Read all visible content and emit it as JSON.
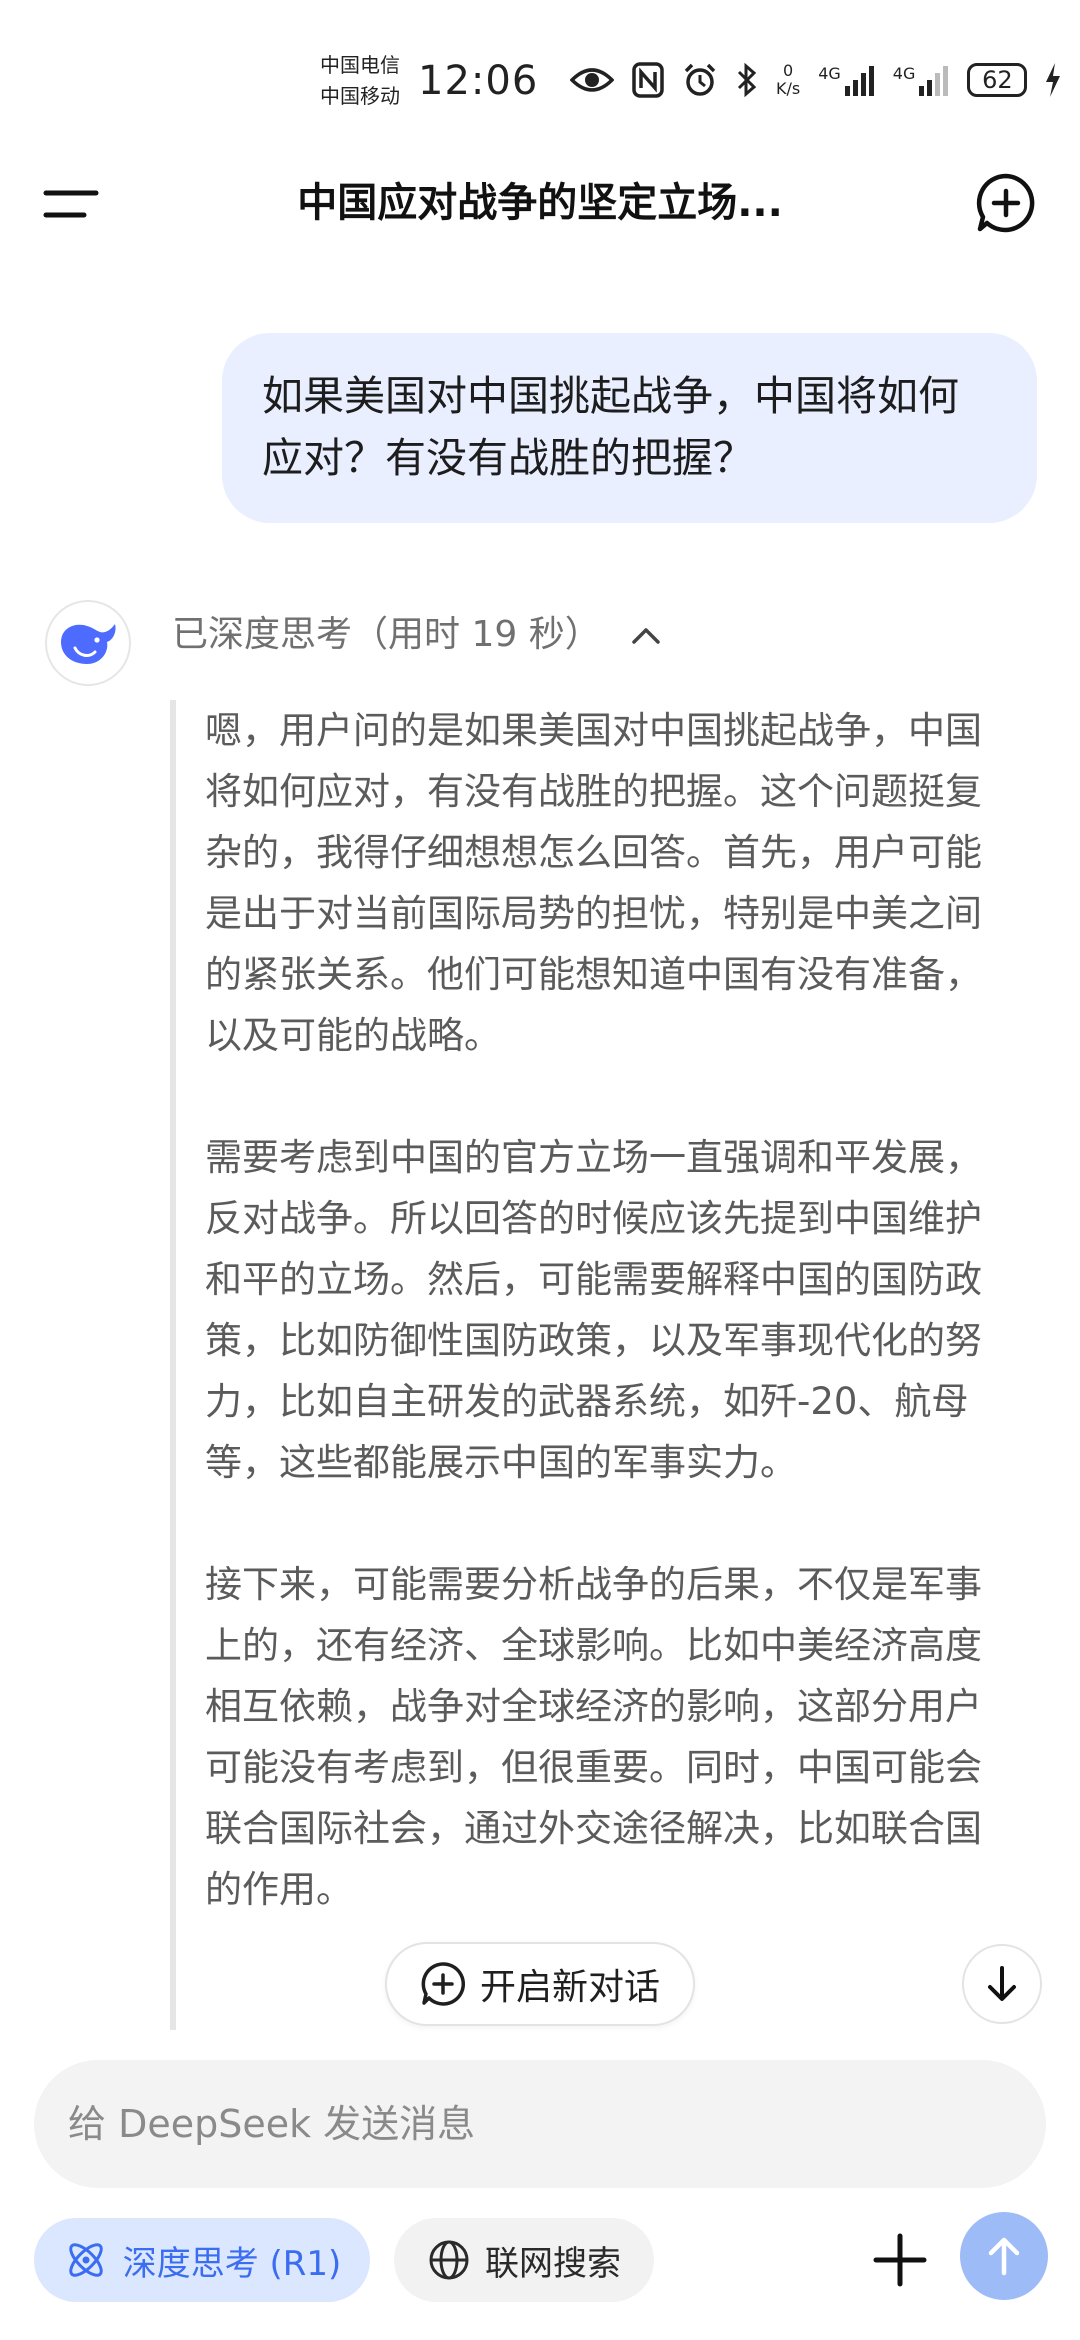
{
  "status_bar": {
    "carrier_1": "中国电信",
    "carrier_2": "中国移动",
    "time": "12:06",
    "speed_value": "0",
    "speed_unit": "K/s",
    "network_1": "4G",
    "network_2": "4G",
    "battery": "62"
  },
  "header": {
    "title": "中国应对战争的坚定立场..."
  },
  "user_message": {
    "text": "如果美国对中国挑起战争，中国将如何应对？有没有战胜的把握？"
  },
  "assistant": {
    "thinking_label": "已深度思考（用时 19 秒）",
    "thinking_paragraphs": [
      "嗯，用户问的是如果美国对中国挑起战争，中国将如何应对，有没有战胜的把握。这个问题挺复杂的，我得仔细想想怎么回答。首先，用户可能是出于对当前国际局势的担忧，特别是中美之间的紧张关系。他们可能想知道中国有没有准备，以及可能的战略。",
      "需要考虑到中国的官方立场一直强调和平发展，反对战争。所以回答的时候应该先提到中国维护和平的立场。然后，可能需要解释中国的国防政策，比如防御性国防政策，以及军事现代化的努力，比如自主研发的武器系统，如歼-20、航母等，这些都能展示中国的军事实力。",
      "接下来，可能需要分析战争的后果，不仅是军事上的，还有经济、全球影响。比如中美经济高度相互依赖，战争对全球经济的影响，这部分用户可能没有考虑到，但很重要。同时，中国可能会联合国际社会，通过外交途径解决，比如联合国的作用。"
    ]
  },
  "floating": {
    "new_conversation_label": "开启新对话"
  },
  "composer": {
    "placeholder": "给 DeepSeek 发送消息",
    "deep_think_label": "深度思考 (R1)",
    "web_search_label": "联网搜索"
  },
  "colors": {
    "accent": "#3b6df0",
    "user_bubble": "#e9efff",
    "send_button": "#9dbbf6"
  },
  "icons": [
    "eye-icon",
    "nfc-icon",
    "alarm-icon",
    "bluetooth-icon",
    "signal-icon",
    "battery-icon",
    "menu-icon",
    "new-chat-icon",
    "deepseek-logo-icon",
    "chevron-up-icon",
    "plus-circle-icon",
    "arrow-down-icon",
    "atom-icon",
    "globe-icon",
    "plus-icon",
    "arrow-up-icon"
  ]
}
